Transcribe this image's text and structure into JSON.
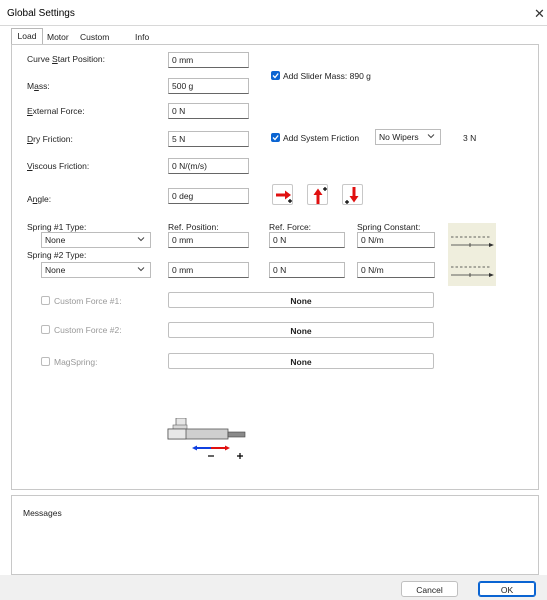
{
  "window": {
    "title": "Global Settings"
  },
  "tabs": [
    {
      "label": "Load"
    },
    {
      "label": "Motor"
    },
    {
      "label": "Custom"
    },
    {
      "label": "Info"
    }
  ],
  "load": {
    "curve_start": {
      "label_pre": "Curve ",
      "label_key": "S",
      "label_post": "tart Position:",
      "value": "0 mm"
    },
    "mass": {
      "label_pre": "M",
      "label_key": "a",
      "label_post": "ss:",
      "value": "500 g"
    },
    "slider_mass": {
      "label": "Add Slider Mass: 890 g",
      "checked": true
    },
    "external_force": {
      "label_pre": "",
      "label_key": "E",
      "label_post": "xternal Force:",
      "value": "0 N"
    },
    "dry_friction": {
      "label_pre": "",
      "label_key": "D",
      "label_post": "ry Friction:",
      "value": "5 N"
    },
    "system_friction": {
      "label": "Add System Friction",
      "checked": true,
      "select_value": "No Wipers",
      "value_text": "3 N"
    },
    "viscous_friction": {
      "label_pre": "",
      "label_key": "V",
      "label_post": "iscous Friction:",
      "value": "0 N/(m/s)"
    },
    "angle": {
      "label_pre": "A",
      "label_key": "n",
      "label_post": "gle:",
      "value": "0 deg"
    },
    "spring_headers": {
      "type1": "Spring #1 Type:",
      "type2": "Spring #2 Type:",
      "ref_position": "Ref. Position:",
      "ref_force": "Ref. Force:",
      "spring_constant": "Spring Constant:"
    },
    "spring1": {
      "type": "None",
      "position": "0 mm",
      "force": "0 N",
      "constant": "0 N/m"
    },
    "spring2": {
      "type": "None",
      "position": "0 mm",
      "force": "0 N",
      "constant": "0 N/m"
    },
    "custom_force_1": {
      "label": "Custom Force #1:",
      "value": "None"
    },
    "custom_force_2": {
      "label": "Custom Force #2:",
      "value": "None"
    },
    "magspring": {
      "label": "MagSpring:",
      "value": "None"
    }
  },
  "messages": {
    "label": "Messages"
  },
  "buttons": {
    "cancel": "Cancel",
    "ok": "OK"
  },
  "icons": {
    "close": "close-icon",
    "dropdown": "chevron-down-icon",
    "orientation": [
      "horizontal-orientation-icon",
      "vertical-up-orientation-icon",
      "vertical-down-orientation-icon"
    ],
    "spring": "spring-diagram-icon",
    "motor": "linear-motor-diagram-icon"
  },
  "colors": {
    "accent": "#0a64d2",
    "arrow_red": "#e01010",
    "arrow_blue": "#1040e0",
    "spring_bg": "#efeedd"
  }
}
